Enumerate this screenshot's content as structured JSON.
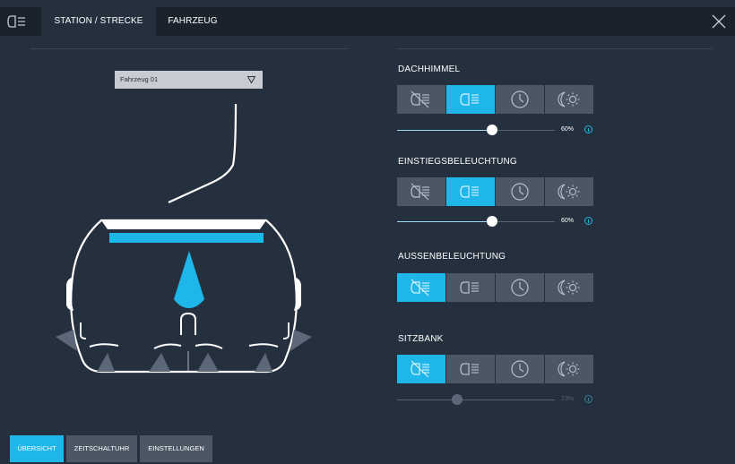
{
  "header": {
    "tabs": [
      {
        "label": "STATION / STRECKE",
        "active": true
      },
      {
        "label": "FAHRZEUG",
        "active": false
      }
    ],
    "menu_icon": "menu-lamp-icon",
    "close_icon": "close-icon"
  },
  "vehicle_select": {
    "value": "Fahrzeug 01"
  },
  "sections": [
    {
      "title": "DACHHIMMEL",
      "active_mode": "on",
      "slider_value": 0.6,
      "slider_label": "60%",
      "slider_enabled": true
    },
    {
      "title": "EINSTIEGSBELEUCHTUNG",
      "active_mode": "on",
      "slider_value": 0.6,
      "slider_label": "60%",
      "slider_enabled": true
    },
    {
      "title": "AUSSENBELEUCHTUNG",
      "active_mode": "off",
      "slider_value": null,
      "slider_label": null,
      "slider_enabled": false
    },
    {
      "title": "SITZBANK",
      "active_mode": "off",
      "slider_value": 0.38,
      "slider_label": "23%",
      "slider_enabled": false
    }
  ],
  "mode_icons": [
    "light-off-icon",
    "light-on-icon",
    "clock-icon",
    "day-night-icon"
  ],
  "bottom_nav": [
    {
      "label": "ÜBERSICHT",
      "active": true
    },
    {
      "label": "ZEITSCHALTUHR",
      "active": false
    },
    {
      "label": "EINSTELLUNGEN",
      "active": false
    }
  ],
  "colors": {
    "accent": "#1fb7ea",
    "background": "#25303e",
    "header": "#1a222c",
    "button": "#4c5766"
  }
}
